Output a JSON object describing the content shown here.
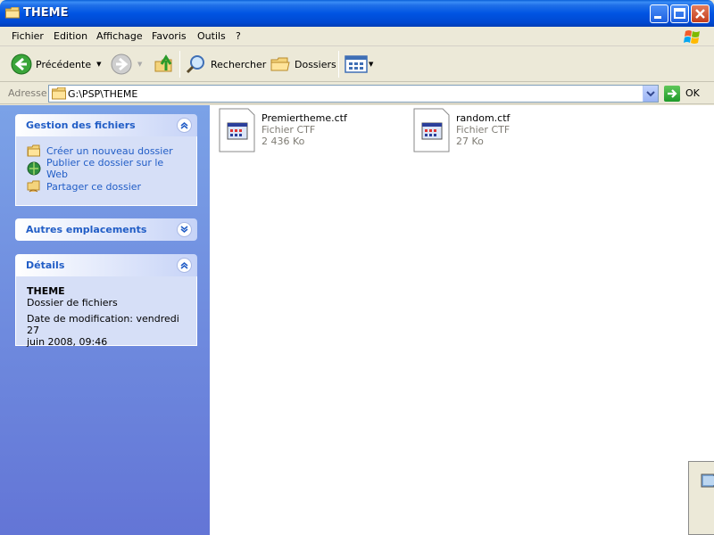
{
  "window": {
    "title": "THEME"
  },
  "menu": [
    "Fichier",
    "Edition",
    "Affichage",
    "Favoris",
    "Outils",
    "?"
  ],
  "toolbar": {
    "back_label": "Précédente",
    "search_label": "Rechercher",
    "folders_label": "Dossiers"
  },
  "address": {
    "label": "Adresse",
    "value": "G:\\PSP\\THEME",
    "go_label": "OK"
  },
  "tasks_panel": {
    "title": "Gestion des fichiers",
    "items": [
      {
        "label": "Créer un nouveau dossier",
        "icon": "new-folder-icon"
      },
      {
        "label": "Publier ce dossier sur le Web",
        "icon": "publish-web-icon"
      },
      {
        "label": "Partager ce dossier",
        "icon": "share-folder-icon"
      }
    ]
  },
  "other_places_panel": {
    "title": "Autres emplacements"
  },
  "details_panel": {
    "title": "Détails",
    "name": "THEME",
    "type": "Dossier de fichiers",
    "modified_line1": "Date de modification: vendredi 27",
    "modified_line2": "juin 2008, 09:46"
  },
  "files": [
    {
      "name": "Premiertheme.ctf",
      "type": "Fichier CTF",
      "size": "2 436 Ko"
    },
    {
      "name": "random.ctf",
      "type": "Fichier CTF",
      "size": "27 Ko"
    }
  ],
  "colors": {
    "titlebar": "#0054e3",
    "taskpane_link": "#215dc6",
    "taskpane_bg_top": "#7ba2e7",
    "taskpane_bg_bottom": "#6375d6"
  }
}
